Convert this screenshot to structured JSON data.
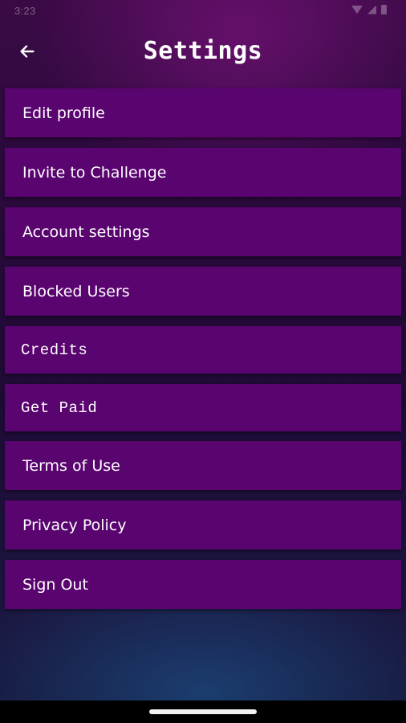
{
  "status_bar": {
    "time": "3:23",
    "icons": [
      "wifi-icon",
      "cell-signal-icon",
      "battery-icon"
    ]
  },
  "header": {
    "title": "Settings",
    "back_icon": "arrow-left-icon"
  },
  "menu": {
    "items": [
      {
        "label": "Edit profile",
        "name": "edit-profile"
      },
      {
        "label": "Invite to Challenge",
        "name": "invite-to-challenge"
      },
      {
        "label": "Account settings",
        "name": "account-settings"
      },
      {
        "label": "Blocked Users",
        "name": "blocked-users"
      },
      {
        "label": "Credits",
        "name": "credits"
      },
      {
        "label": "Get Paid",
        "name": "get-paid"
      },
      {
        "label": "Terms of Use",
        "name": "terms-of-use"
      },
      {
        "label": "Privacy Policy",
        "name": "privacy-policy"
      },
      {
        "label": "Sign Out",
        "name": "sign-out"
      }
    ]
  },
  "colors": {
    "menu_item_bg": "#5a0470",
    "text": "#ffffff",
    "background_top": "#3a0a45",
    "background_bottom": "#15173a"
  }
}
